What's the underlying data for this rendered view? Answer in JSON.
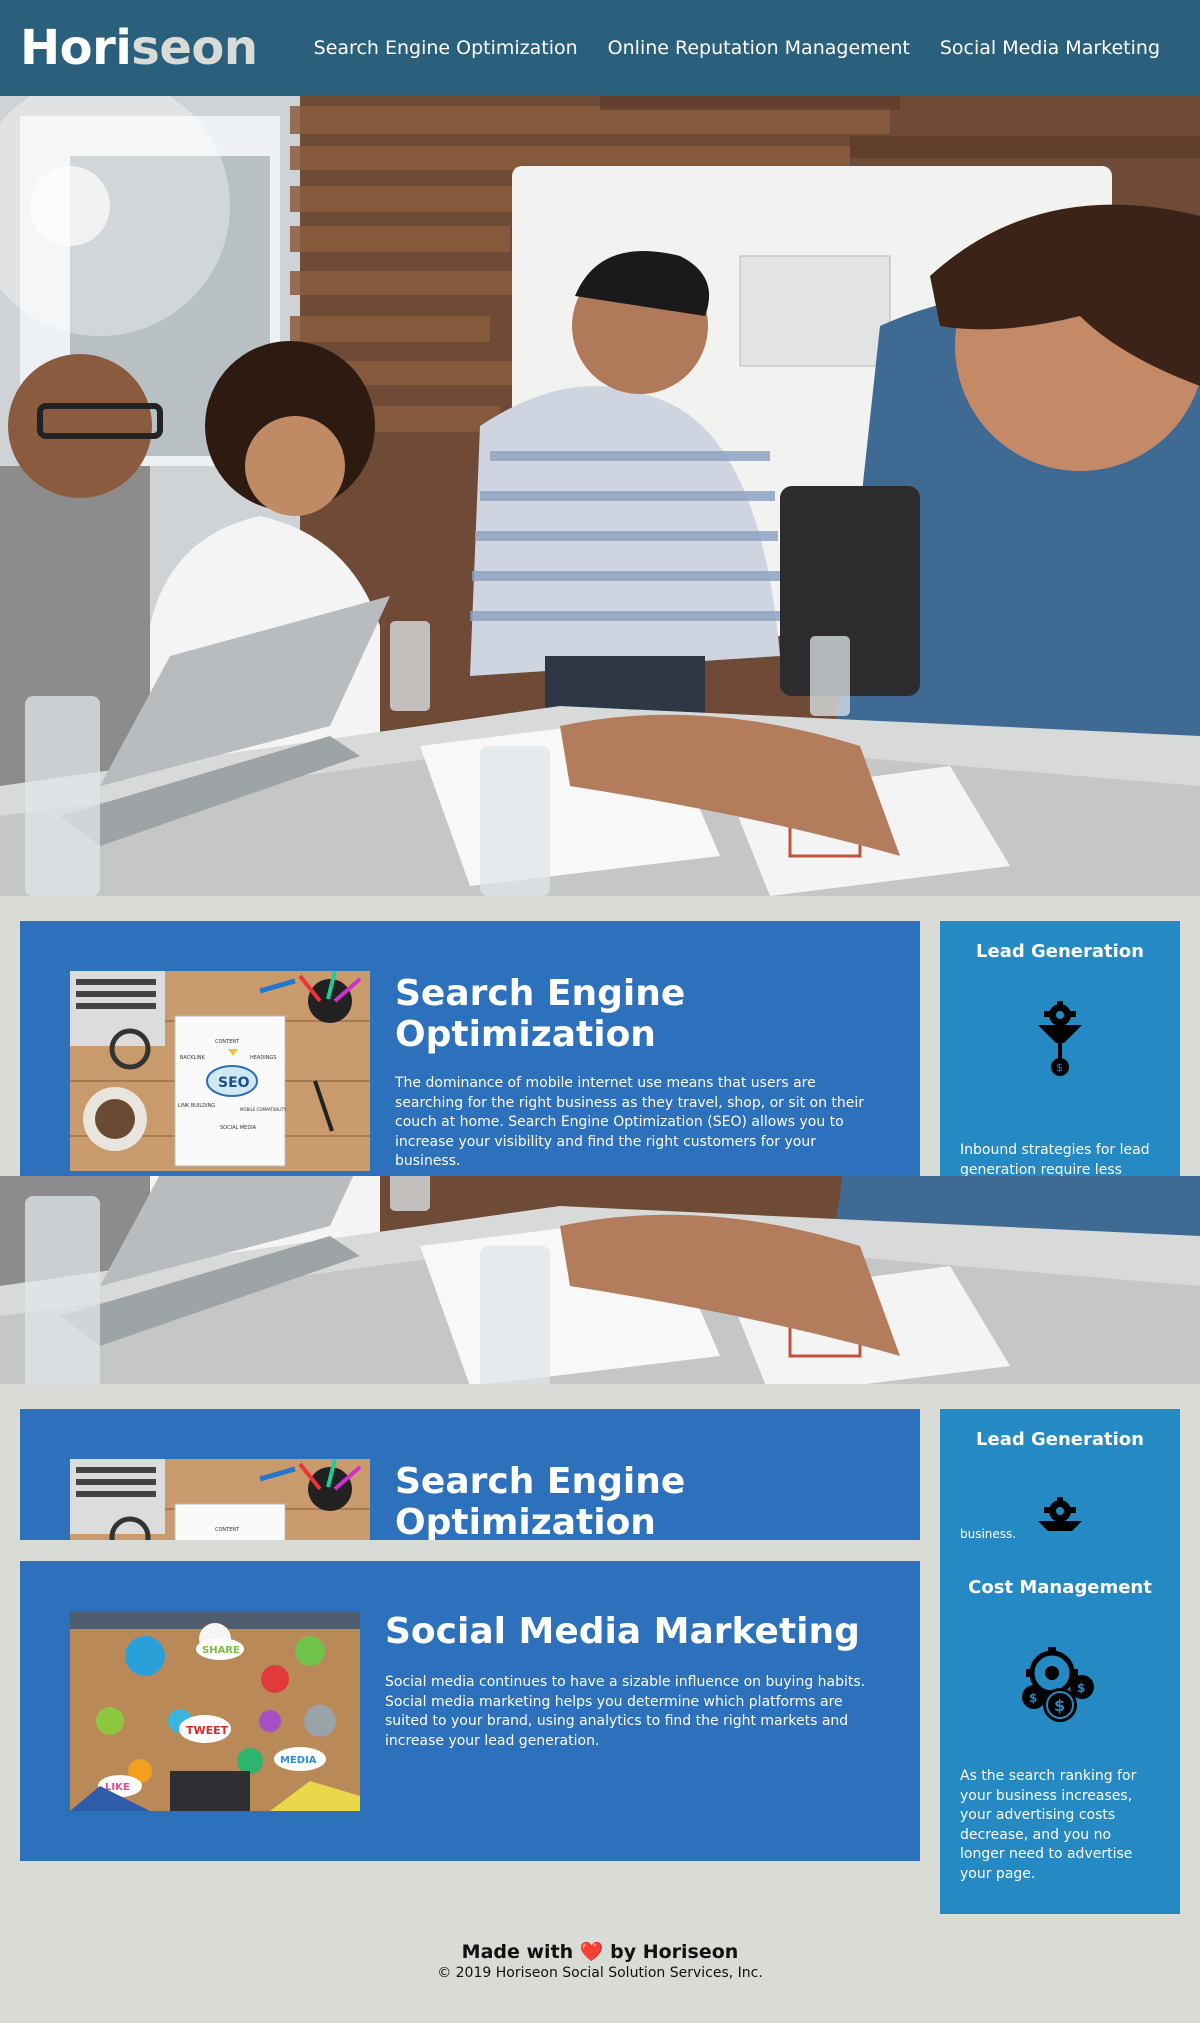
{
  "header": {
    "logo_part1": "Hori",
    "logo_part2": "seon",
    "nav": [
      "Search Engine Optimization",
      "Online Reputation Management",
      "Social Media Marketing"
    ]
  },
  "content": {
    "seo": {
      "title": "Search Engine Optimization",
      "text": "The dominance of mobile internet use means that users are searching for the right business as they travel, shop, or sit on their couch at home. Search Engine Optimization (SEO) allows you to increase your visibility and find the right customers for your business.",
      "image_labels": [
        "CONTENT",
        "BACKLINK",
        "HEADINGS",
        "SEO",
        "LINK BUILDING",
        "MOBILE COMPATIBILITY",
        "SOCIAL MEDIA"
      ]
    },
    "social": {
      "title": "Social Media Marketing",
      "text": "Social media continues to have a sizable influence on buying habits. Social media marketing helps you determine which platforms are suited to your brand, using analytics to find the right markets and increase your lead generation.",
      "image_labels": [
        "SHARE",
        "TWEET",
        "LIKE",
        "MEDIA"
      ]
    }
  },
  "benefits": {
    "lead": {
      "title": "Lead Generation",
      "text": "Inbound strategies for lead generation require less work",
      "text_tail": "business."
    },
    "cost": {
      "title": "Cost Management",
      "text": "As the search ranking for your business increases, your advertising costs decrease, and you no longer need to advertise your page."
    }
  },
  "footer": {
    "made_prefix": "Made with",
    "heart": "❤️",
    "made_suffix": "by Horiseon",
    "copyright": "© 2019 Horiseon Social Solution Services, Inc."
  },
  "colors": {
    "header_bg": "#2a607c",
    "page_bg": "#d9dcd6",
    "card_bg": "#2d70bb",
    "benefit_bg": "#2589c4"
  }
}
